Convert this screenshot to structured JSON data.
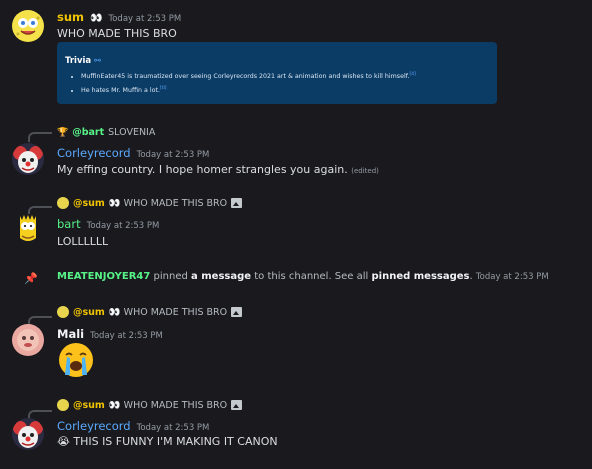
{
  "messages": [
    {
      "username": "sum",
      "username_color": "#f0c300",
      "tag": "👀",
      "timestamp": "Today at 2:53 PM",
      "text": "WHO MADE THIS BRO",
      "embed": {
        "title": "Trivia",
        "link_icon": "link-icon",
        "bullets": [
          {
            "text": "MuffinEater45 is traumatized over seeing Corleyrecords 2021 art & animation and wishes to kill himself.",
            "ref": "[4]"
          },
          {
            "text": "He hates Mr. Muffin a lot.",
            "ref": "[tl]"
          }
        ]
      }
    },
    {
      "reply_user": "@bart",
      "reply_user_color": "#57f287",
      "reply_text": "SLOVENIA",
      "username": "Corleyrecord",
      "username_color": "#5aa9ff",
      "timestamp": "Today at 2:53 PM",
      "text": "My effing country. I hope homer strangles you again.",
      "edited": "(edited)"
    },
    {
      "reply_user": "@sum",
      "reply_user_color": "#f0c300",
      "reply_text": "👀 WHO MADE THIS BRO",
      "username": "bart",
      "username_color": "#57f287",
      "timestamp": "Today at 2:53 PM",
      "text": "LOLLLLLL"
    },
    {
      "system": true,
      "username": "MEATENJOYER47",
      "username_color": "#57f287",
      "text_a": "pinned",
      "text_link_a": "a message",
      "text_b": "to this channel. See all",
      "text_link_b": "pinned messages",
      "text_c": ".",
      "timestamp": "Today at 2:53 PM"
    },
    {
      "reply_user": "@sum",
      "reply_user_color": "#f0c300",
      "reply_text": "👀 WHO MADE THIS BRO",
      "username": "Mali",
      "username_color": "#f2f3f5",
      "timestamp": "Today at 2:53 PM",
      "emoji": "loudly-crying-emoji"
    },
    {
      "reply_user": "@sum",
      "reply_user_color": "#f0c300",
      "reply_text": "👀 WHO MADE THIS BRO",
      "username": "Corleyrecord",
      "username_color": "#5aa9ff",
      "timestamp": "Today at 2:53 PM",
      "text": "😭 THIS IS FUNNY I'M MAKING IT CANON"
    }
  ]
}
